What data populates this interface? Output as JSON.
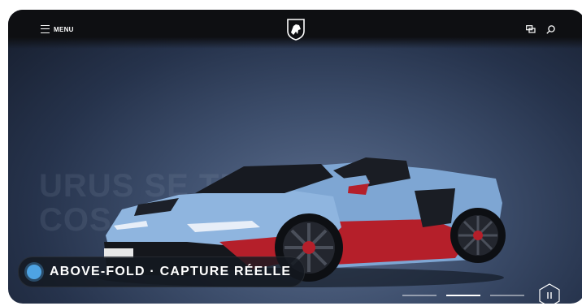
{
  "header": {
    "menu_label": "MENU",
    "logo_icon": "bull-shield-logo-icon",
    "chat_icon": "chat-bubbles-icon",
    "search_icon": "search-icon"
  },
  "hero": {
    "background_ghost_text": [
      "URUS SE TETTONIACO",
      "COS"
    ],
    "badge_label": "ABOVE-FOLD · CAPTURE RÉELLE",
    "accent_color": "#4ea3e3",
    "car_body_color": "#86aedb",
    "car_accent_color": "#c1232d"
  },
  "carousel": {
    "slide_count": 3,
    "active_index": 1,
    "pause_icon": "pause-icon"
  }
}
